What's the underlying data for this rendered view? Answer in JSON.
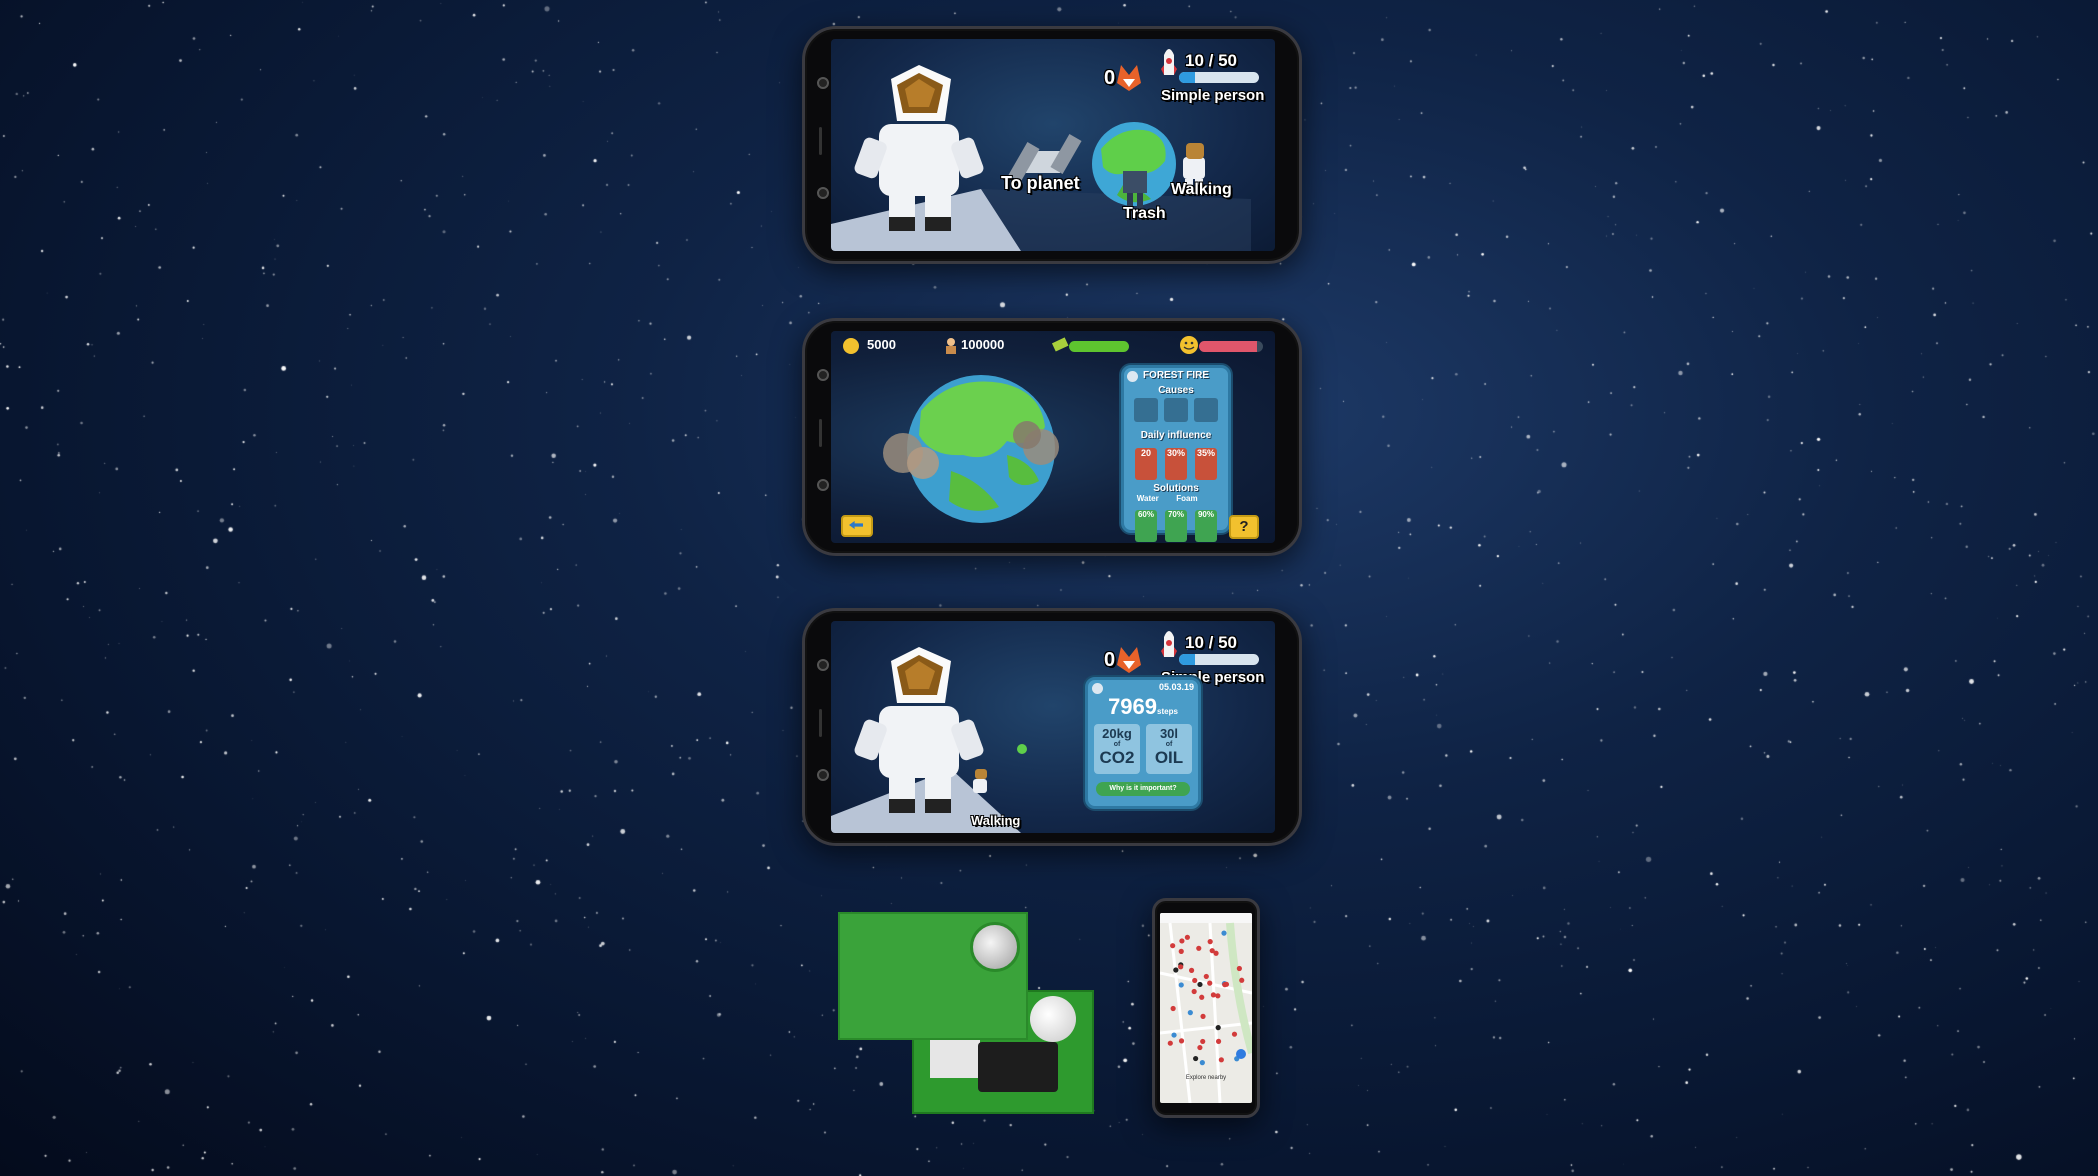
{
  "screen1": {
    "coin_count": "0",
    "progress_text": "10 / 50",
    "progress_fraction": 0.2,
    "rank": "Simple person",
    "labels": {
      "to_planet": "To planet",
      "trash": "Trash",
      "walking": "Walking"
    }
  },
  "screen2": {
    "coins": "5000",
    "population": "100000",
    "money_bar": 1.0,
    "happiness_bar": 0.9,
    "panel": {
      "title": "FOREST FIRE",
      "causes": "Causes",
      "daily_influence": "Daily influence",
      "influence_values": [
        "20",
        "30%",
        "35%"
      ],
      "solutions": "Solutions",
      "solution_names": [
        "Water",
        "Foam"
      ],
      "solution_percents": [
        "60%",
        "70%",
        "90%"
      ]
    },
    "help_label": "?"
  },
  "screen3": {
    "coin_count": "0",
    "progress_text": "10 / 50",
    "progress_fraction": 0.2,
    "rank": "Simple person",
    "walking": "Walking",
    "stats": {
      "date": "05.03.19",
      "steps_value": "7969",
      "steps_unit": "steps",
      "co2_amount": "20kg",
      "co2_of": "of",
      "co2_label": "CO2",
      "oil_amount": "30l",
      "oil_of": "of",
      "oil_label": "OIL",
      "button": "Why is it important?"
    }
  },
  "map_phone": {
    "explore_label": "Explore nearby"
  },
  "colors": {
    "accent_blue": "#2f9be0",
    "panel_blue": "#4a9cc8",
    "box_green": "#3aa33a",
    "fox_orange": "#e8622a"
  }
}
